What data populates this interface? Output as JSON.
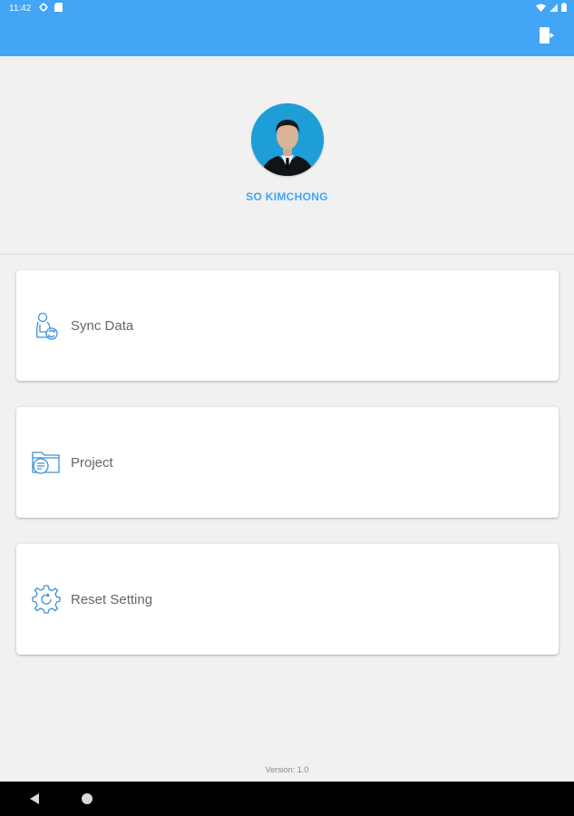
{
  "status_bar": {
    "time": "11:42",
    "icons": [
      "gear-icon",
      "sd-card-icon",
      "wifi-icon",
      "signal-icon",
      "battery-icon"
    ]
  },
  "app_bar": {
    "color": "#42a5f5",
    "actions": [
      "logout-icon"
    ]
  },
  "profile": {
    "name": "SO KIMCHONG",
    "avatar": "profile-photo"
  },
  "menu": {
    "items": [
      {
        "label": "Sync Data",
        "icon": "sync-user-icon"
      },
      {
        "label": "Project",
        "icon": "folder-document-icon"
      },
      {
        "label": "Reset Setting",
        "icon": "gear-reset-icon"
      }
    ]
  },
  "footer": {
    "version": "Version: 1.0"
  },
  "nav_bar": {
    "buttons": [
      "back-icon",
      "home-icon"
    ]
  },
  "colors": {
    "accent": "#42a5f5",
    "background": "#f1f1f1",
    "card": "#ffffff",
    "label": "#666666"
  }
}
